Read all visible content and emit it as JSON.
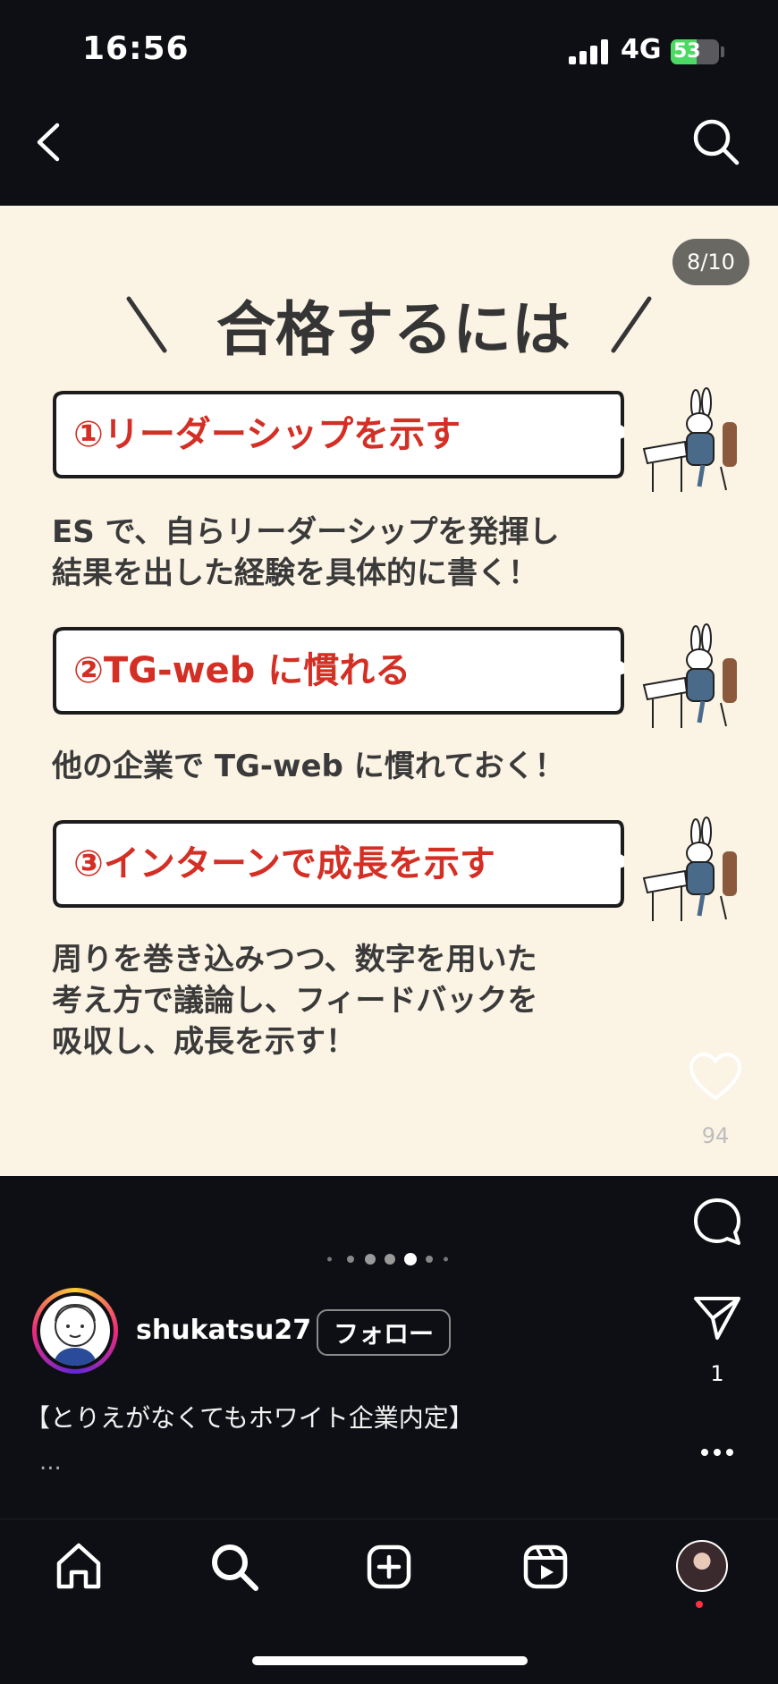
{
  "status_bar": {
    "time": "16:56",
    "network": "4G",
    "battery": "53",
    "battery_level": 0.53
  },
  "nav": {
    "back_icon": "chevron-left-icon",
    "search_icon": "search-icon"
  },
  "post": {
    "counter": "8/10",
    "heading": "合格するには",
    "items": [
      {
        "label": "①リーダーシップを示す",
        "desc": [
          "ES で、自らリーダーシップを発揮し",
          "結果を出した経験を具体的に書く！"
        ]
      },
      {
        "label": "②TG-web に慣れる",
        "desc": [
          "他の企業で TG-web に慣れておく！"
        ]
      },
      {
        "label": "③インターンで成長を示す",
        "desc": [
          "周りを巻き込みつつ、数字を用いた",
          "考え方で議論し、フィードバックを",
          "吸収し、成長を示す！"
        ]
      }
    ]
  },
  "actions": {
    "likes": "94",
    "shares": "1"
  },
  "author": {
    "username": "shukatsu27",
    "follow_label": "フォロー"
  },
  "caption": {
    "text": "【とりえがなくてもホワイト企業内定】",
    "more": "..."
  },
  "colors": {
    "accent_red": "#d32f25",
    "post_bg": "#fbf3e4",
    "app_bg": "#0e0f14"
  }
}
